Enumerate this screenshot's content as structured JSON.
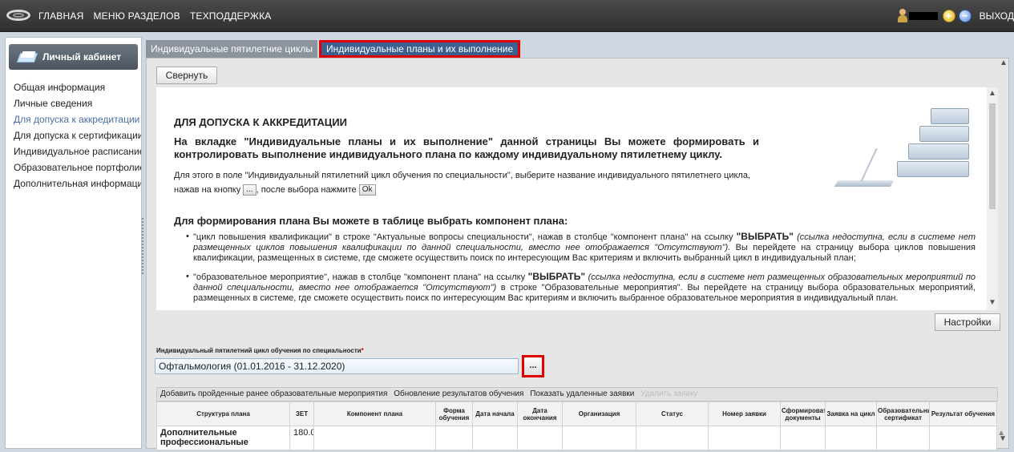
{
  "topnav": {
    "home": "ГЛАВНАЯ",
    "sections": "МЕНЮ РАЗДЕЛОВ",
    "support": "ТЕХПОДДЕРЖКА",
    "exit": "ВЫХОД"
  },
  "sidebar": {
    "cabinet_title": "Личный кабинет",
    "items": [
      {
        "label": "Общая информация"
      },
      {
        "label": "Личные сведения"
      },
      {
        "label": "Для допуска к аккредитации"
      },
      {
        "label": "Для допуска к сертификации"
      },
      {
        "label": "Индивидуальное расписание"
      },
      {
        "label": "Образовательное портфолио"
      },
      {
        "label": "Дополнительная информация"
      }
    ]
  },
  "tabs": [
    {
      "label": "Индивидуальные пятилетние циклы"
    },
    {
      "label": "Индивидуальные планы и их выполнение"
    }
  ],
  "main": {
    "collapse_label": "Свернуть",
    "settings_label": "Настройки",
    "info": {
      "heading": "ДЛЯ ДОПУСКА К АККРЕДИТАЦИИ",
      "subheading": "На вкладке \"Индивидуальные планы и их выполнение\" данной страницы Вы можете формировать и контролировать выполнение индивидуального плана по каждому индивидуальному пятилетнему циклу.",
      "p1": "Для этого в поле \"Индивидуальный пятилетний цикл обучения по специальности\", выберите название индивидуального пятилетнего цикла,",
      "p2_a": "нажав на кнопку",
      "p2_btn1": "...",
      "p2_b": ", после выбора нажмите",
      "p2_btn2": "Ok",
      "heading2": "Для формирования плана Вы можете в таблице выбрать компонент плана:",
      "bullet1_a": "\"цикл повышения квалификации\" в строке \"Актуальные вопросы специальности\", нажав в столбце \"компонент плана\" на ссылку ",
      "bullet1_link": "\"ВЫБРАТЬ\"",
      "bullet1_em": " (ссылка недоступна, если в системе нет размещенных циклов повышения квалификации по данной специальности, вместо нее отображается \"Отсутствуют\").",
      "bullet1_b": " Вы перейдете на страницу выбора циклов повышения квалификации, размещенных в системе, где сможете осуществить поиск по интересующим Вас критериям и включить выбранный цикл в индивидуальный план;",
      "bullet2_a": "\"образовательное мероприятие\", нажав в столбце \"компонент плана\" на ссылку ",
      "bullet2_link": "\"ВЫБРАТЬ\"",
      "bullet2_em": " (ссылка недоступна, если в системе нет размещенных образовательных мероприятий по данной специальности, вместо нее отображается \"Отсутствуют\")",
      "bullet2_b": " в строке \"Образовательные мероприятия\". Вы перейдете на страницу выбора образовательных мероприятий, размещенных в системе, где сможете осуществить поиск по интересующим Вас критериям и включить выбранное образовательное мероприятия в индивидуальный план."
    },
    "cycle_label": "Индивидуальный пятилетний цикл обучения по специальности",
    "cycle_required": "*",
    "cycle_value": "Офтальмология (01.01.2016 - 31.12.2020)",
    "pick_label": "...",
    "toolbar": {
      "add": "Добавить пройденные ранее образовательные мероприятия",
      "update": "Обновление результатов обучения",
      "show_deleted": "Показать удаленные заявки",
      "delete": "Удалить заявку"
    },
    "table": {
      "headers": [
        "Структура плана",
        "ЗЕТ",
        "Компонент плана",
        "Форма обучения",
        "Дата начала",
        "Дата окончания",
        "Организация",
        "Статус",
        "Номер заявки",
        "Сформировать документы",
        "Заявка на цикл",
        "Образовательный сертификат",
        "Результат обучения"
      ],
      "rows": [
        {
          "structure": "Дополнительные профессиональные",
          "zet": "180.0"
        }
      ]
    }
  }
}
